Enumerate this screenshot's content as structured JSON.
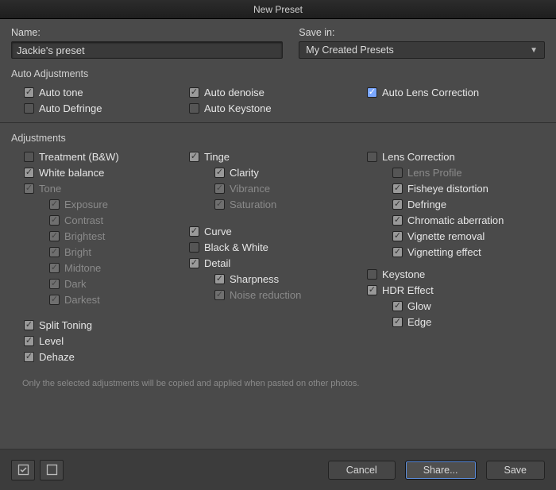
{
  "title": "New Preset",
  "name_label": "Name:",
  "name_value": "Jackie's preset",
  "savein_label": "Save in:",
  "savein_value": "My Created Presets",
  "section_auto": "Auto Adjustments",
  "section_adj": "Adjustments",
  "auto": {
    "tone": "Auto tone",
    "denoise": "Auto denoise",
    "lens": "Auto Lens Correction",
    "defringe": "Auto Defringe",
    "keystone": "Auto Keystone"
  },
  "col1": {
    "treatment": "Treatment (B&W)",
    "wb": "White balance",
    "tone": "Tone",
    "exposure": "Exposure",
    "contrast": "Contrast",
    "brightest": "Brightest",
    "bright": "Bright",
    "midtone": "Midtone",
    "dark": "Dark",
    "darkest": "Darkest",
    "split": "Split Toning",
    "level": "Level",
    "dehaze": "Dehaze"
  },
  "col2": {
    "tinge": "Tinge",
    "clarity": "Clarity",
    "vibrance": "Vibrance",
    "saturation": "Saturation",
    "curve": "Curve",
    "bw": "Black & White",
    "detail": "Detail",
    "sharpness": "Sharpness",
    "noise": "Noise reduction"
  },
  "col3": {
    "lenscorr": "Lens Correction",
    "lensprofile": "Lens Profile",
    "fisheye": "Fisheye distortion",
    "defringe": "Defringe",
    "chroma": "Chromatic aberration",
    "vigrem": "Vignette removal",
    "vigeff": "Vignetting effect",
    "keystone": "Keystone",
    "hdr": "HDR Effect",
    "glow": "Glow",
    "edge": "Edge"
  },
  "footnote": "Only the selected adjustments will be copied and applied when pasted on other photos.",
  "buttons": {
    "cancel": "Cancel",
    "share": "Share...",
    "save": "Save"
  }
}
